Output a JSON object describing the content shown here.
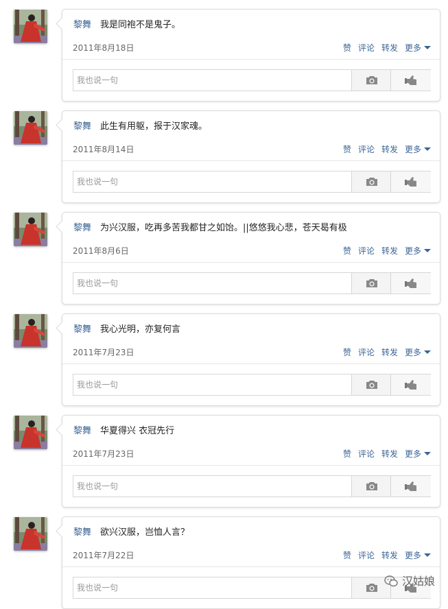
{
  "labels": {
    "like": "赞",
    "comment": "评论",
    "share": "转发",
    "more": "更多",
    "input_placeholder": "我也说一句"
  },
  "posts": [
    {
      "author": "黎舞",
      "text": "我是同袍不是鬼子。",
      "date": "2011年8月18日"
    },
    {
      "author": "黎舞",
      "text": "此生有用躯，报于汉家魂。",
      "date": "2011年8月14日"
    },
    {
      "author": "黎舞",
      "text": "为兴汉服，吃再多苦我都甘之如饴。||悠悠我心悲，苍天曷有极",
      "date": "2011年8月6日"
    },
    {
      "author": "黎舞",
      "text": "我心光明，亦复何言",
      "date": "2011年7月23日"
    },
    {
      "author": "黎舞",
      "text": "华夏得兴 衣冠先行",
      "date": "2011年7月23日"
    },
    {
      "author": "黎舞",
      "text": "欲兴汉服，岂恤人言？",
      "date": "2011年7月22日"
    }
  ],
  "watermark": {
    "text": "汉姑娘",
    "icon": "wechat-icon"
  },
  "colors": {
    "link": "#3b6596",
    "border": "#dcdcdc",
    "avatar_red": "#c8332b"
  }
}
